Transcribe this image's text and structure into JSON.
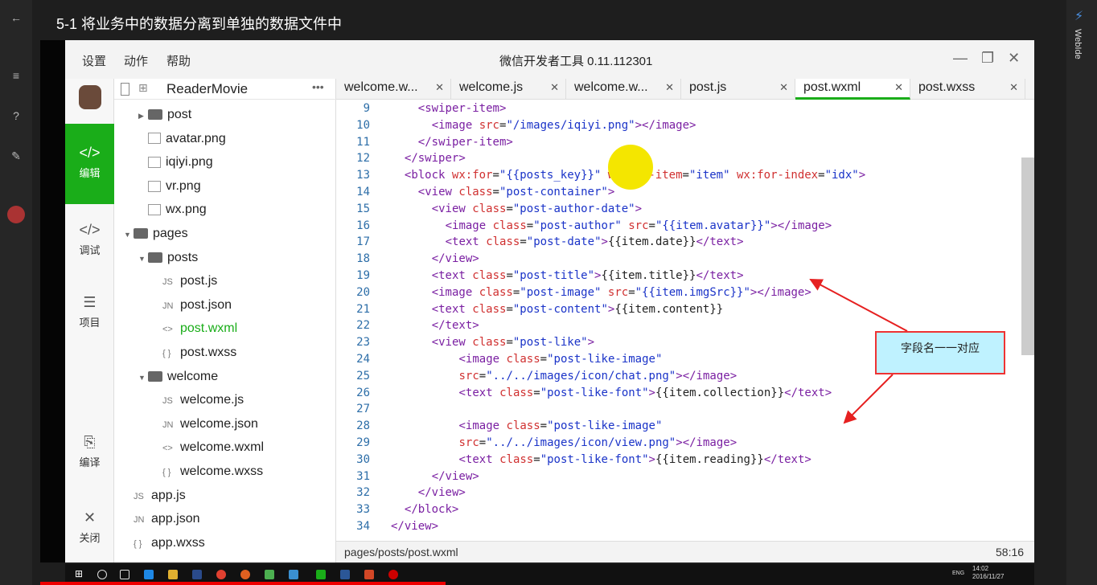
{
  "video_title": "5-1 将业务中的数据分离到单独的数据文件中",
  "webide_label": "WebIde",
  "menu": [
    "设置",
    "动作",
    "帮助"
  ],
  "ide_title": "微信开发者工具 0.11.112301",
  "tools": [
    {
      "label": "编辑",
      "icon": "code-icon"
    },
    {
      "label": "调试",
      "icon": "debug-icon"
    },
    {
      "label": "项目",
      "icon": "list-icon"
    },
    {
      "label": "编译",
      "icon": "compile-icon"
    },
    {
      "label": "关闭",
      "icon": "close-icon"
    }
  ],
  "project_name": "ReaderMovie",
  "tree": [
    {
      "name": "post",
      "kind": "folder",
      "depth": 1,
      "expanded": false
    },
    {
      "name": "avatar.png",
      "kind": "image",
      "depth": 1
    },
    {
      "name": "iqiyi.png",
      "kind": "image",
      "depth": 1
    },
    {
      "name": "vr.png",
      "kind": "image",
      "depth": 1
    },
    {
      "name": "wx.png",
      "kind": "image",
      "depth": 1
    },
    {
      "name": "pages",
      "kind": "folder",
      "depth": 0,
      "expanded": true
    },
    {
      "name": "posts",
      "kind": "folder",
      "depth": 1,
      "expanded": true
    },
    {
      "name": "post.js",
      "kind": "js",
      "depth": 2
    },
    {
      "name": "post.json",
      "kind": "json",
      "depth": 2
    },
    {
      "name": "post.wxml",
      "kind": "wxml",
      "depth": 2,
      "active": true
    },
    {
      "name": "post.wxss",
      "kind": "wxss",
      "depth": 2
    },
    {
      "name": "welcome",
      "kind": "folder",
      "depth": 1,
      "expanded": true
    },
    {
      "name": "welcome.js",
      "kind": "js",
      "depth": 2
    },
    {
      "name": "welcome.json",
      "kind": "json",
      "depth": 2
    },
    {
      "name": "welcome.wxml",
      "kind": "wxml",
      "depth": 2
    },
    {
      "name": "welcome.wxss",
      "kind": "wxss",
      "depth": 2
    },
    {
      "name": "app.js",
      "kind": "js",
      "depth": 0
    },
    {
      "name": "app.json",
      "kind": "json",
      "depth": 0
    },
    {
      "name": "app.wxss",
      "kind": "wxss",
      "depth": 0
    }
  ],
  "file_icons": {
    "js": "JS",
    "json": "JN",
    "wxml": "<>",
    "wxss": "{ }"
  },
  "tabs": [
    {
      "label": "welcome.w..."
    },
    {
      "label": "welcome.js"
    },
    {
      "label": "welcome.w..."
    },
    {
      "label": "post.js"
    },
    {
      "label": "post.wxml",
      "active": true
    },
    {
      "label": "post.wxss"
    }
  ],
  "code": [
    {
      "n": "9",
      "i": 4,
      "t": "<swiper-item>"
    },
    {
      "n": "10",
      "i": 6,
      "t": "<image src=\"/images/iqiyi.png\"></image>"
    },
    {
      "n": "11",
      "i": 4,
      "t": "</swiper-item>"
    },
    {
      "n": "12",
      "i": 2,
      "t": "</swiper>"
    },
    {
      "n": "13",
      "i": 2,
      "t": "<block wx:for=\"{{posts_key}}\" wx:for-item=\"item\" wx:for-index=\"idx\">"
    },
    {
      "n": "14",
      "i": 4,
      "t": "<view class=\"post-container\">"
    },
    {
      "n": "15",
      "i": 6,
      "t": "<view class=\"post-author-date\">"
    },
    {
      "n": "16",
      "i": 8,
      "t": "<image class=\"post-author\" src=\"{{item.avatar}}\"></image>"
    },
    {
      "n": "17",
      "i": 8,
      "t": "<text class=\"post-date\">{{item.date}}</text>"
    },
    {
      "n": "18",
      "i": 6,
      "t": "</view>"
    },
    {
      "n": "19",
      "i": 6,
      "t": "<text class=\"post-title\">{{item.title}}</text>"
    },
    {
      "n": "20",
      "i": 6,
      "t": "<image class=\"post-image\" src=\"{{item.imgSrc}}\"></image>"
    },
    {
      "n": "21",
      "i": 6,
      "t": "<text class=\"post-content\">{{item.content}}"
    },
    {
      "n": "22",
      "i": 6,
      "t": "</text>"
    },
    {
      "n": "23",
      "i": 6,
      "t": "<view class=\"post-like\">"
    },
    {
      "n": "24",
      "i": 10,
      "t": "<image class=\"post-like-image\""
    },
    {
      "n": "25",
      "i": 10,
      "t": "src=\"../../images/icon/chat.png\"></image>"
    },
    {
      "n": "26",
      "i": 10,
      "t": "<text class=\"post-like-font\">{{item.collection}}</text>"
    },
    {
      "n": "27",
      "i": 0,
      "t": ""
    },
    {
      "n": "28",
      "i": 10,
      "t": "<image class=\"post-like-image\""
    },
    {
      "n": "29",
      "i": 10,
      "t": "src=\"../../images/icon/view.png\"></image>"
    },
    {
      "n": "30",
      "i": 10,
      "t": "<text class=\"post-like-font\">{{item.reading}}</text>"
    },
    {
      "n": "31",
      "i": 6,
      "t": "</view>"
    },
    {
      "n": "32",
      "i": 4,
      "t": "</view>"
    },
    {
      "n": "33",
      "i": 2,
      "t": "</block>"
    },
    {
      "n": "34",
      "i": 0,
      "t": "</view>"
    }
  ],
  "callout": "字段名一一对应",
  "status": {
    "path": "pages/posts/post.wxml",
    "position": "58:16"
  },
  "taskbar": {
    "lang": "ENG",
    "time": "14:02",
    "date": "2016/11/27"
  },
  "colors": {
    "accent": "#1aad19",
    "tag": "#7a1fa2",
    "attr": "#d03030",
    "value": "#1a33c8",
    "arrow": "#e62020"
  }
}
